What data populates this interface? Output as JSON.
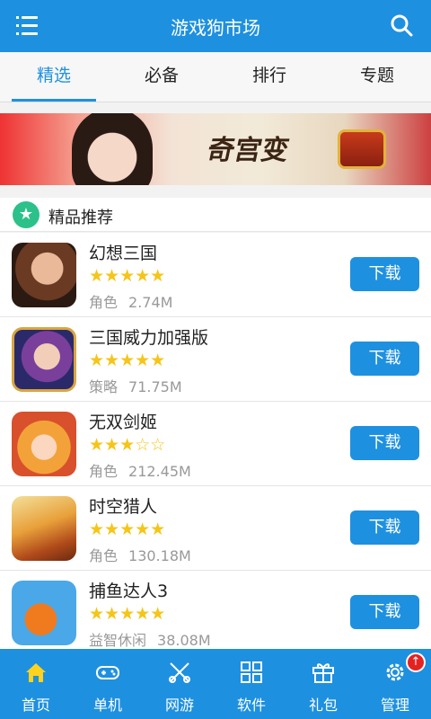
{
  "header": {
    "title": "游戏狗市场",
    "menu_icon": "menu-icon",
    "search_icon": "search-icon",
    "color": "#1e90e0"
  },
  "tabs": [
    {
      "label": "精选",
      "active": true
    },
    {
      "label": "必备",
      "active": false
    },
    {
      "label": "排行",
      "active": false
    },
    {
      "label": "专题",
      "active": false
    }
  ],
  "banner": {
    "text": "奇宫变"
  },
  "section": {
    "title": "精品推荐",
    "icon": "star-icon"
  },
  "apps": [
    {
      "name": "幻想三国",
      "rating": 5,
      "category": "角色",
      "size": "2.74M",
      "button": "下载"
    },
    {
      "name": "三国威力加强版",
      "rating": 5,
      "category": "策略",
      "size": "71.75M",
      "button": "下载"
    },
    {
      "name": "无双剑姬",
      "rating": 3,
      "category": "角色",
      "size": "212.45M",
      "button": "下载"
    },
    {
      "name": "时空猎人",
      "rating": 5,
      "category": "角色",
      "size": "130.18M",
      "button": "下载"
    },
    {
      "name": "捕鱼达人3",
      "rating": 5,
      "category": "益智休闲",
      "size": "38.08M",
      "button": "下载"
    }
  ],
  "bottom_nav": [
    {
      "label": "首页",
      "icon": "home-icon",
      "active": true
    },
    {
      "label": "单机",
      "icon": "gamepad-icon",
      "active": false
    },
    {
      "label": "网游",
      "icon": "network-game-icon",
      "active": false
    },
    {
      "label": "软件",
      "icon": "grid-apps-icon",
      "active": false
    },
    {
      "label": "礼包",
      "icon": "gift-icon",
      "active": false
    },
    {
      "label": "管理",
      "icon": "gear-icon",
      "active": false,
      "badge": "↑"
    }
  ]
}
